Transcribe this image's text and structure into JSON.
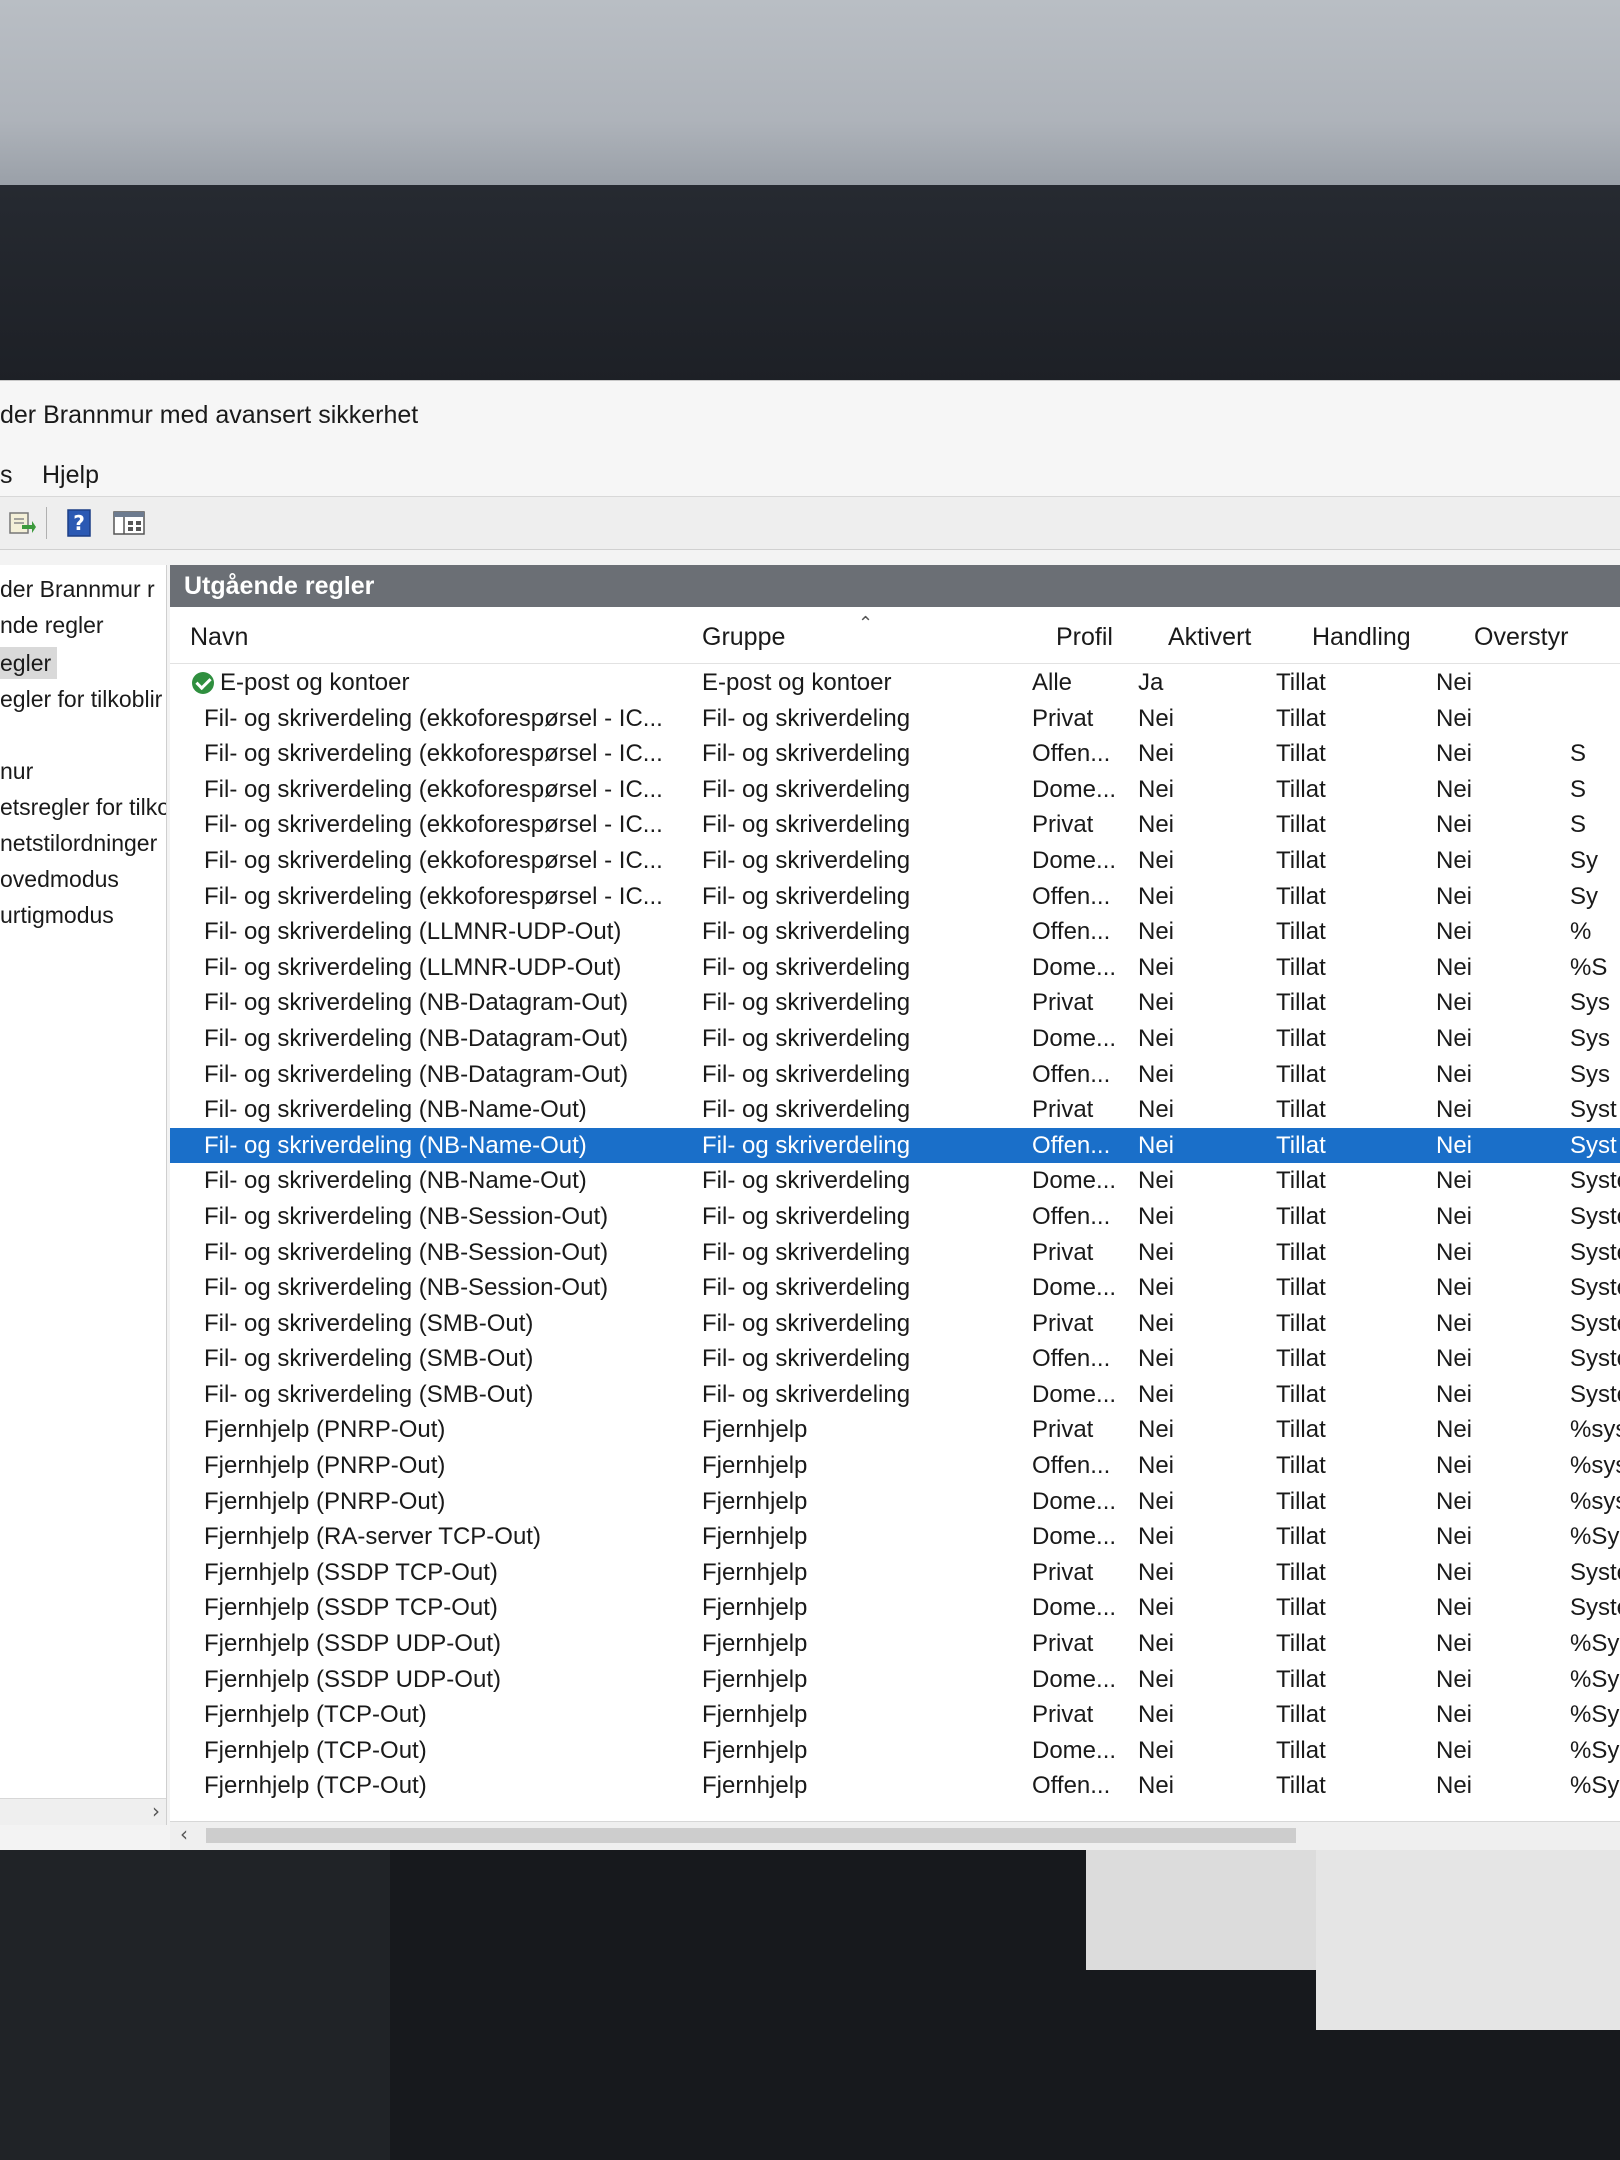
{
  "window": {
    "title": "der Brannmur med avansert sikkerhet"
  },
  "menu": {
    "items": [
      "s",
      "Hjelp"
    ]
  },
  "toolbar": {
    "icons": [
      "export-icon",
      "help-icon",
      "view-icon"
    ]
  },
  "tree": {
    "items": [
      {
        "label": "der Brannmur r",
        "selected": false
      },
      {
        "label": "nde regler",
        "selected": false
      },
      {
        "label": "egler",
        "selected": true
      },
      {
        "label": "egler for tilkoblir",
        "selected": false
      },
      {
        "label": "",
        "selected": false
      },
      {
        "label": "nur",
        "selected": false
      },
      {
        "label": "etsregler for tilko",
        "selected": false
      },
      {
        "label": "netstilordninger",
        "selected": false
      },
      {
        "label": "ovedmodus",
        "selected": false
      },
      {
        "label": "urtigmodus",
        "selected": false
      }
    ]
  },
  "main": {
    "section_title": "Utgående regler",
    "columns": {
      "name": "Navn",
      "group": "Gruppe",
      "profile": "Profil",
      "enabled": "Aktivert",
      "action": "Handling",
      "override": "Overstyr"
    },
    "rows": [
      {
        "name": "E-post og kontoer",
        "group": "E-post og kontoer",
        "profile": "Alle",
        "enabled": "Ja",
        "action": "Tillat",
        "override": "Nei",
        "program": "",
        "icon": "check-icon"
      },
      {
        "name": "Fil- og skriverdeling (ekkoforespørsel - IC...",
        "group": "Fil- og skriverdeling",
        "profile": "Privat",
        "enabled": "Nei",
        "action": "Tillat",
        "override": "Nei",
        "program": ""
      },
      {
        "name": "Fil- og skriverdeling (ekkoforespørsel - IC...",
        "group": "Fil- og skriverdeling",
        "profile": "Offen...",
        "enabled": "Nei",
        "action": "Tillat",
        "override": "Nei",
        "program": "S"
      },
      {
        "name": "Fil- og skriverdeling (ekkoforespørsel - IC...",
        "group": "Fil- og skriverdeling",
        "profile": "Dome...",
        "enabled": "Nei",
        "action": "Tillat",
        "override": "Nei",
        "program": "S"
      },
      {
        "name": "Fil- og skriverdeling (ekkoforespørsel - IC...",
        "group": "Fil- og skriverdeling",
        "profile": "Privat",
        "enabled": "Nei",
        "action": "Tillat",
        "override": "Nei",
        "program": "S"
      },
      {
        "name": "Fil- og skriverdeling (ekkoforespørsel - IC...",
        "group": "Fil- og skriverdeling",
        "profile": "Dome...",
        "enabled": "Nei",
        "action": "Tillat",
        "override": "Nei",
        "program": "Sy"
      },
      {
        "name": "Fil- og skriverdeling (ekkoforespørsel - IC...",
        "group": "Fil- og skriverdeling",
        "profile": "Offen...",
        "enabled": "Nei",
        "action": "Tillat",
        "override": "Nei",
        "program": "Sy"
      },
      {
        "name": "Fil- og skriverdeling (LLMNR-UDP-Out)",
        "group": "Fil- og skriverdeling",
        "profile": "Offen...",
        "enabled": "Nei",
        "action": "Tillat",
        "override": "Nei",
        "program": "%"
      },
      {
        "name": "Fil- og skriverdeling (LLMNR-UDP-Out)",
        "group": "Fil- og skriverdeling",
        "profile": "Dome...",
        "enabled": "Nei",
        "action": "Tillat",
        "override": "Nei",
        "program": "%S"
      },
      {
        "name": "Fil- og skriverdeling (NB-Datagram-Out)",
        "group": "Fil- og skriverdeling",
        "profile": "Privat",
        "enabled": "Nei",
        "action": "Tillat",
        "override": "Nei",
        "program": "Sys"
      },
      {
        "name": "Fil- og skriverdeling (NB-Datagram-Out)",
        "group": "Fil- og skriverdeling",
        "profile": "Dome...",
        "enabled": "Nei",
        "action": "Tillat",
        "override": "Nei",
        "program": "Sys"
      },
      {
        "name": "Fil- og skriverdeling (NB-Datagram-Out)",
        "group": "Fil- og skriverdeling",
        "profile": "Offen...",
        "enabled": "Nei",
        "action": "Tillat",
        "override": "Nei",
        "program": "Sys"
      },
      {
        "name": "Fil- og skriverdeling (NB-Name-Out)",
        "group": "Fil- og skriverdeling",
        "profile": "Privat",
        "enabled": "Nei",
        "action": "Tillat",
        "override": "Nei",
        "program": "Syst"
      },
      {
        "name": "Fil- og skriverdeling (NB-Name-Out)",
        "group": "Fil- og skriverdeling",
        "profile": "Offen...",
        "enabled": "Nei",
        "action": "Tillat",
        "override": "Nei",
        "program": "Syst",
        "selected": true
      },
      {
        "name": "Fil- og skriverdeling (NB-Name-Out)",
        "group": "Fil- og skriverdeling",
        "profile": "Dome...",
        "enabled": "Nei",
        "action": "Tillat",
        "override": "Nei",
        "program": "Syste"
      },
      {
        "name": "Fil- og skriverdeling (NB-Session-Out)",
        "group": "Fil- og skriverdeling",
        "profile": "Offen...",
        "enabled": "Nei",
        "action": "Tillat",
        "override": "Nei",
        "program": "Syste"
      },
      {
        "name": "Fil- og skriverdeling (NB-Session-Out)",
        "group": "Fil- og skriverdeling",
        "profile": "Privat",
        "enabled": "Nei",
        "action": "Tillat",
        "override": "Nei",
        "program": "Syste"
      },
      {
        "name": "Fil- og skriverdeling (NB-Session-Out)",
        "group": "Fil- og skriverdeling",
        "profile": "Dome...",
        "enabled": "Nei",
        "action": "Tillat",
        "override": "Nei",
        "program": "Syster"
      },
      {
        "name": "Fil- og skriverdeling (SMB-Out)",
        "group": "Fil- og skriverdeling",
        "profile": "Privat",
        "enabled": "Nei",
        "action": "Tillat",
        "override": "Nei",
        "program": "Syster"
      },
      {
        "name": "Fil- og skriverdeling (SMB-Out)",
        "group": "Fil- og skriverdeling",
        "profile": "Offen...",
        "enabled": "Nei",
        "action": "Tillat",
        "override": "Nei",
        "program": "Systen"
      },
      {
        "name": "Fil- og skriverdeling (SMB-Out)",
        "group": "Fil- og skriverdeling",
        "profile": "Dome...",
        "enabled": "Nei",
        "action": "Tillat",
        "override": "Nei",
        "program": "Systen"
      },
      {
        "name": "Fjernhjelp (PNRP-Out)",
        "group": "Fjernhjelp",
        "profile": "Privat",
        "enabled": "Nei",
        "action": "Tillat",
        "override": "Nei",
        "program": "%syste"
      },
      {
        "name": "Fjernhjelp (PNRP-Out)",
        "group": "Fjernhjelp",
        "profile": "Offen...",
        "enabled": "Nei",
        "action": "Tillat",
        "override": "Nei",
        "program": "%syster"
      },
      {
        "name": "Fjernhjelp (PNRP-Out)",
        "group": "Fjernhjelp",
        "profile": "Dome...",
        "enabled": "Nei",
        "action": "Tillat",
        "override": "Nei",
        "program": "%syster"
      },
      {
        "name": "Fjernhjelp (RA-server TCP-Out)",
        "group": "Fjernhjelp",
        "profile": "Dome...",
        "enabled": "Nei",
        "action": "Tillat",
        "override": "Nei",
        "program": "%Systen"
      },
      {
        "name": "Fjernhjelp (SSDP TCP-Out)",
        "group": "Fjernhjelp",
        "profile": "Privat",
        "enabled": "Nei",
        "action": "Tillat",
        "override": "Nei",
        "program": "System"
      },
      {
        "name": "Fjernhjelp (SSDP TCP-Out)",
        "group": "Fjernhjelp",
        "profile": "Dome...",
        "enabled": "Nei",
        "action": "Tillat",
        "override": "Nei",
        "program": "System"
      },
      {
        "name": "Fjernhjelp (SSDP UDP-Out)",
        "group": "Fjernhjelp",
        "profile": "Privat",
        "enabled": "Nei",
        "action": "Tillat",
        "override": "Nei",
        "program": "%System"
      },
      {
        "name": "Fjernhjelp (SSDP UDP-Out)",
        "group": "Fjernhjelp",
        "profile": "Dome...",
        "enabled": "Nei",
        "action": "Tillat",
        "override": "Nei",
        "program": "%System."
      },
      {
        "name": "Fjernhjelp (TCP-Out)",
        "group": "Fjernhjelp",
        "profile": "Privat",
        "enabled": "Nei",
        "action": "Tillat",
        "override": "Nei",
        "program": "%System.."
      },
      {
        "name": "Fjernhjelp (TCP-Out)",
        "group": "Fjernhjelp",
        "profile": "Dome...",
        "enabled": "Nei",
        "action": "Tillat",
        "override": "Nei",
        "program": "%System.."
      },
      {
        "name": "Fjernhjelp (TCP-Out)",
        "group": "Fjernhjelp",
        "profile": "Offen...",
        "enabled": "Nei",
        "action": "Tillat",
        "override": "Nei",
        "program": "%System..."
      }
    ]
  },
  "colors": {
    "selection": "#1a6fc9",
    "section_header": "#6b6f75",
    "check": "#2f8f3f"
  }
}
